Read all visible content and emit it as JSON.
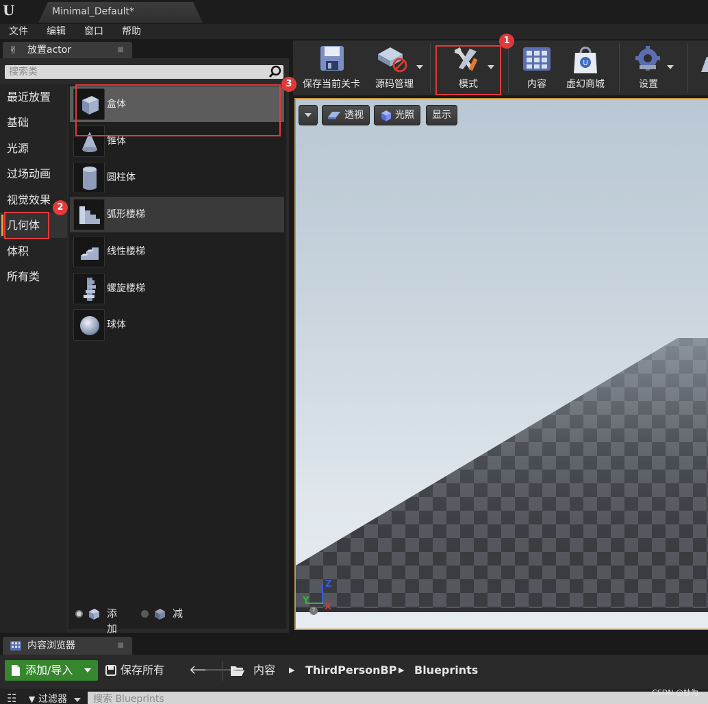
{
  "window": {
    "tab_title": "Minimal_Default*"
  },
  "menu": [
    "文件",
    "编辑",
    "窗口",
    "帮助"
  ],
  "place_panel": {
    "tab_label": "放置actor",
    "search_placeholder": "搜索类",
    "categories": [
      "最近放置",
      "基础",
      "光源",
      "过场动画",
      "视觉效果",
      "几何体",
      "体积",
      "所有类"
    ],
    "selected_category": "几何体",
    "items": [
      "盒体",
      "锥体",
      "圆柱体",
      "弧形楼梯",
      "线性楼梯",
      "螺旋楼梯",
      "球体"
    ],
    "add_label": "添加",
    "subtract_label": "减"
  },
  "toolbar": {
    "save": "保存当前关卡",
    "source_control": "源码管理",
    "modes": "模式",
    "content": "内容",
    "marketplace": "虚幻商城",
    "settings": "设置"
  },
  "viewport": {
    "perspective": "透视",
    "lit": "光照",
    "show": "显示",
    "axis_z": "Z",
    "axis_y": "Y",
    "axis_x": "X"
  },
  "content_browser": {
    "tab_label": "内容浏览器",
    "add_import": "添加/导入",
    "save_all": "保存所有",
    "path": [
      "内容",
      "ThirdPersonBP",
      "Blueprints"
    ],
    "filters": "过滤器",
    "search_placeholder": "搜索 Blueprints"
  },
  "annotations": [
    "1",
    "2",
    "3"
  ],
  "watermark": "CSDN @妙为",
  "colors": {
    "highlight": "#e03b3b",
    "accent": "#e8a33d",
    "add_button": "#36862e"
  }
}
